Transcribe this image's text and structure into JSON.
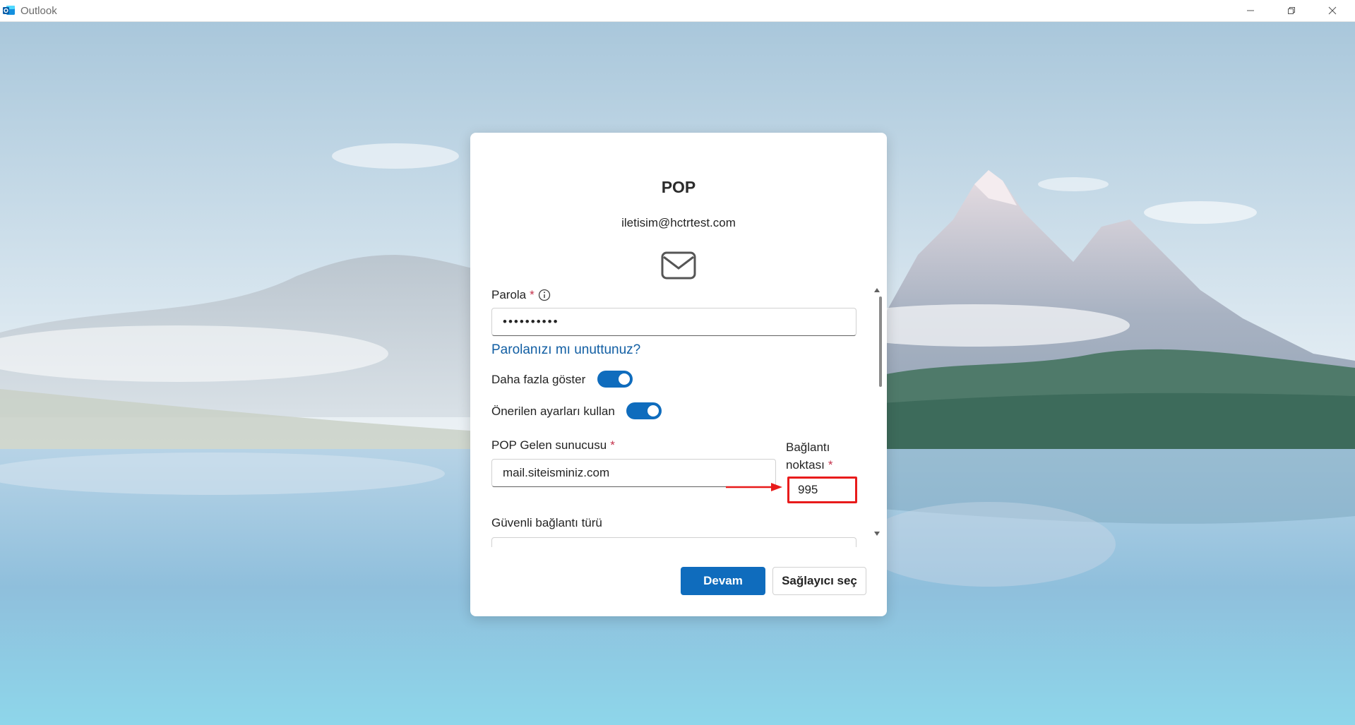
{
  "window": {
    "title": "Outlook",
    "minimize_icon": "minimize-icon",
    "restore_icon": "restore-icon",
    "close_icon": "close-icon"
  },
  "dialog": {
    "title": "POP",
    "email": "iletisim@hctrtest.com",
    "mail_icon": "envelope-icon",
    "password": {
      "label": "Parola",
      "required_mark": "*",
      "info_icon": "info-icon",
      "value": "••••••••••"
    },
    "forgot_link": "Parolanızı mı unuttunuz?",
    "show_more": {
      "label": "Daha fazla göster",
      "on": true
    },
    "use_recommended": {
      "label": "Önerilen ayarları kullan",
      "on": true
    },
    "incoming_server": {
      "label": "POP Gelen sunucusu",
      "required_mark": "*",
      "value": "mail.siteisminiz.com"
    },
    "port": {
      "label_line1": "Bağlantı",
      "label_line2": "noktası",
      "required_mark": "*",
      "value": "995"
    },
    "secure_connection": {
      "label": "Güvenli bağlantı türü"
    },
    "buttons": {
      "continue": "Devam",
      "choose_provider": "Sağlayıcı seç"
    }
  },
  "colors": {
    "accent": "#0f6cbd",
    "link": "#115ea3",
    "required": "#c4314b",
    "annotation": "#e81b1b"
  }
}
